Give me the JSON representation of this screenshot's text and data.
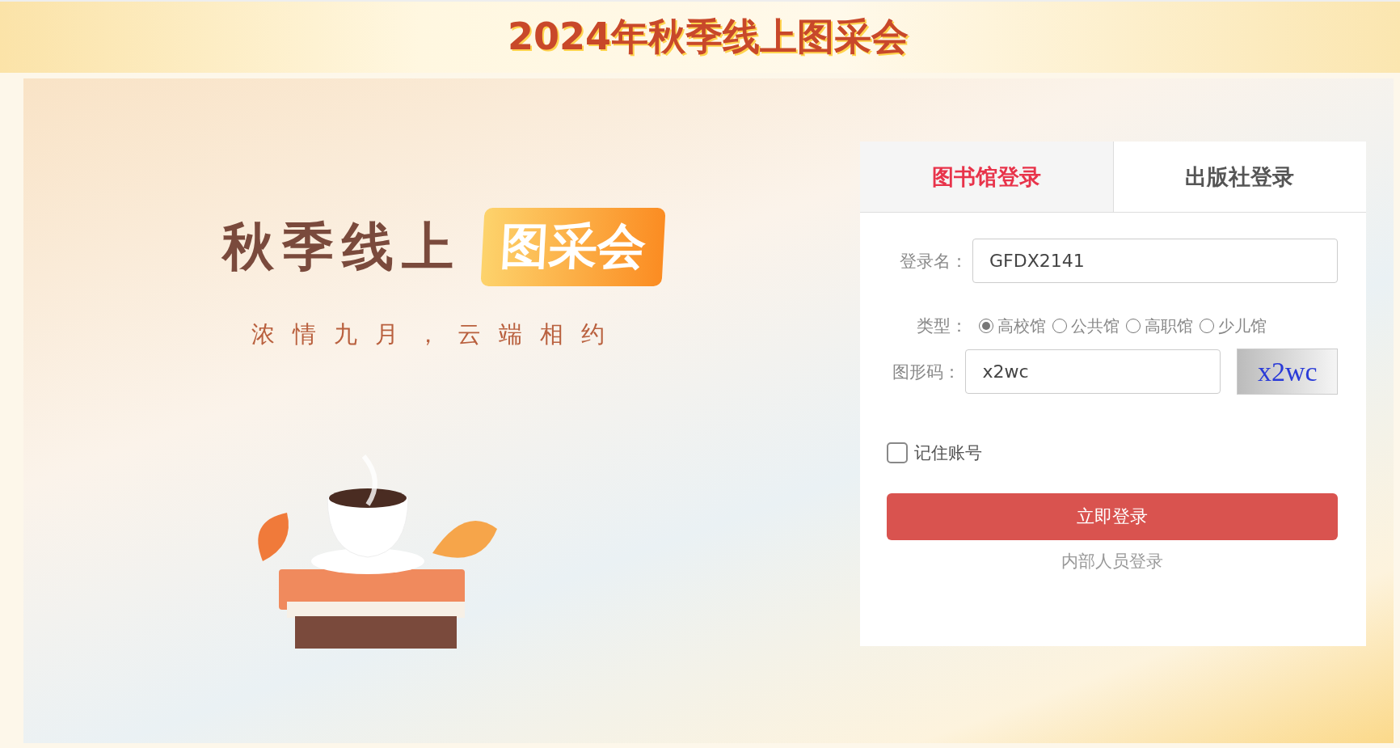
{
  "header": {
    "title": "2024年秋季线上图采会"
  },
  "hero": {
    "title": "秋季线上",
    "badge": "图采会",
    "subtitle": "浓情九月，云端相约"
  },
  "login": {
    "tabs": [
      {
        "label": "图书馆登录",
        "selected": true
      },
      {
        "label": "出版社登录",
        "selected": false
      }
    ],
    "username": {
      "label": "登录名：",
      "value": "GFDX2141"
    },
    "type": {
      "label": "类型：",
      "options": [
        {
          "label": "高校馆",
          "selected": true
        },
        {
          "label": "公共馆",
          "selected": false
        },
        {
          "label": "高职馆",
          "selected": false
        },
        {
          "label": "少儿馆",
          "selected": false
        }
      ]
    },
    "captcha": {
      "label": "图形码：",
      "value": "x2wc",
      "image_text": "x2wc"
    },
    "remember": {
      "label": "记住账号",
      "checked": false
    },
    "submit": "立即登录",
    "staff_link": "内部人员登录"
  }
}
